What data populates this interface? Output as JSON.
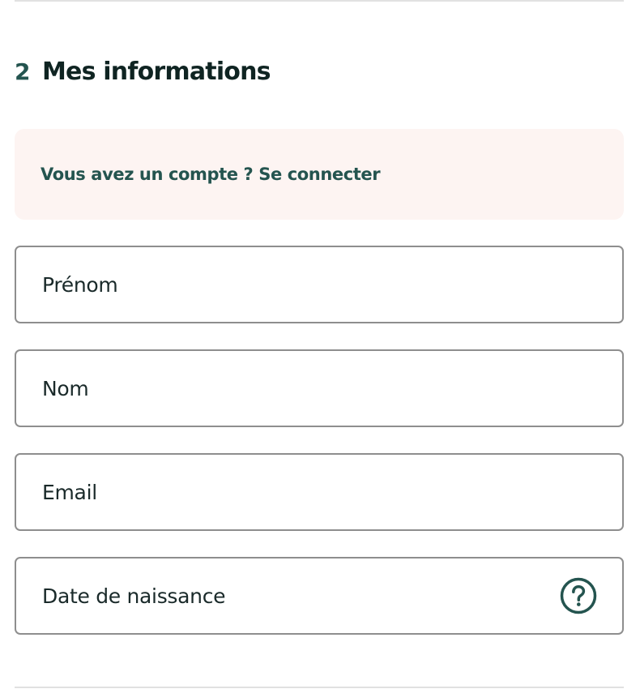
{
  "section": {
    "step_number": "2",
    "title": "Mes informations"
  },
  "login_banner": {
    "text": "Vous avez un compte ? Se connecter"
  },
  "form": {
    "firstname": {
      "placeholder": "Prénom",
      "value": ""
    },
    "lastname": {
      "placeholder": "Nom",
      "value": ""
    },
    "email": {
      "placeholder": "Email",
      "value": ""
    },
    "birthdate": {
      "placeholder": "Date de naissance",
      "value": "",
      "help_icon": "question-circle-icon"
    }
  },
  "colors": {
    "accent": "#24544f",
    "title": "#0f2422",
    "banner_background": "#fdf4f2",
    "field_border": "#8e8e8e",
    "divider": "#e1e1e1"
  }
}
